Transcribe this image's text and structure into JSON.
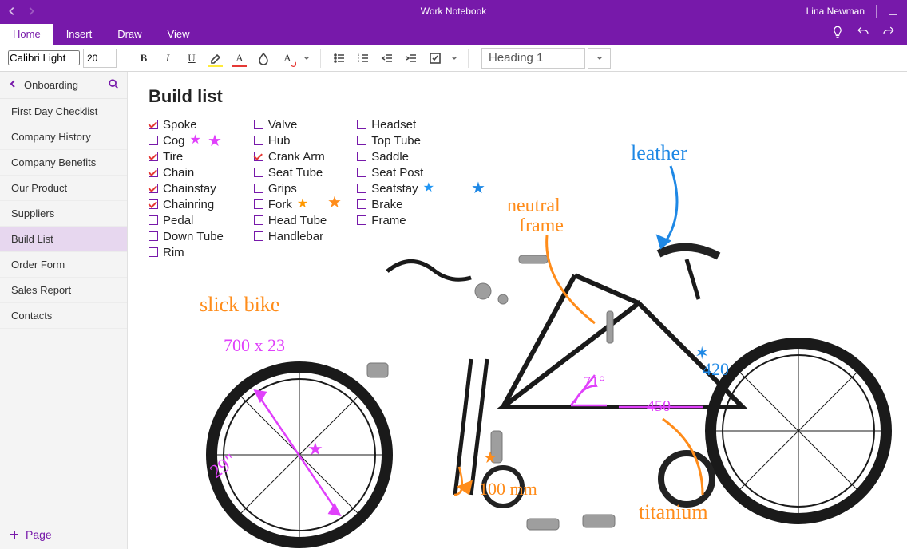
{
  "window": {
    "title": "Work Notebook",
    "user": "Lina Newman"
  },
  "tabs": {
    "items": [
      "Home",
      "Insert",
      "Draw",
      "View"
    ],
    "active": 0
  },
  "ribbon": {
    "font_name": "Calibri Light",
    "font_size": "20",
    "style_picker": "Heading 1"
  },
  "sidebar": {
    "section": "Onboarding",
    "pages": [
      "First Day Checklist",
      "Company History",
      "Company Benefits",
      "Our Product",
      "Suppliers",
      "Build List",
      "Order Form",
      "Sales Report",
      "Contacts"
    ],
    "selected_index": 5,
    "add_label": "Page"
  },
  "page": {
    "title": "Build list",
    "cols": [
      [
        {
          "label": "Spoke",
          "checked": true
        },
        {
          "label": "Cog",
          "checked": false,
          "star": "pink"
        },
        {
          "label": "Tire",
          "checked": true
        },
        {
          "label": "Chain",
          "checked": true
        },
        {
          "label": "Chainstay",
          "checked": true
        },
        {
          "label": "Chainring",
          "checked": true
        },
        {
          "label": "Pedal",
          "checked": false
        },
        {
          "label": "Down Tube",
          "checked": false
        },
        {
          "label": "Rim",
          "checked": false
        }
      ],
      [
        {
          "label": "Valve",
          "checked": false
        },
        {
          "label": "Hub",
          "checked": false
        },
        {
          "label": "Crank Arm",
          "checked": true
        },
        {
          "label": "Seat Tube",
          "checked": false
        },
        {
          "label": "Grips",
          "checked": false
        },
        {
          "label": "Fork",
          "checked": false,
          "star": "orange"
        },
        {
          "label": "Head Tube",
          "checked": false
        },
        {
          "label": "Handlebar",
          "checked": false
        }
      ],
      [
        {
          "label": "Headset",
          "checked": false
        },
        {
          "label": "Top Tube",
          "checked": false
        },
        {
          "label": "Saddle",
          "checked": false
        },
        {
          "label": "Seat Post",
          "checked": false
        },
        {
          "label": "Seatstay",
          "checked": false,
          "star": "blue"
        },
        {
          "label": "Brake",
          "checked": false
        },
        {
          "label": "Frame",
          "checked": false
        }
      ]
    ]
  },
  "ink": {
    "orange": {
      "slick_bike": "slick bike",
      "neutral_frame_1": "neutral",
      "neutral_frame_2": "frame",
      "hundred_mm": "100 mm",
      "titanium": "titanium"
    },
    "blue": {
      "leather": "leather",
      "fourtwenty": "420"
    },
    "pink": {
      "wheel_size": "700 x 23",
      "wheel_diam": "29\"",
      "angle": "71°",
      "length": "450"
    }
  },
  "colors": {
    "brand": "#7719aa",
    "orange": "#ff8c1a",
    "blue": "#1e88e5",
    "pink": "#e040fb"
  }
}
